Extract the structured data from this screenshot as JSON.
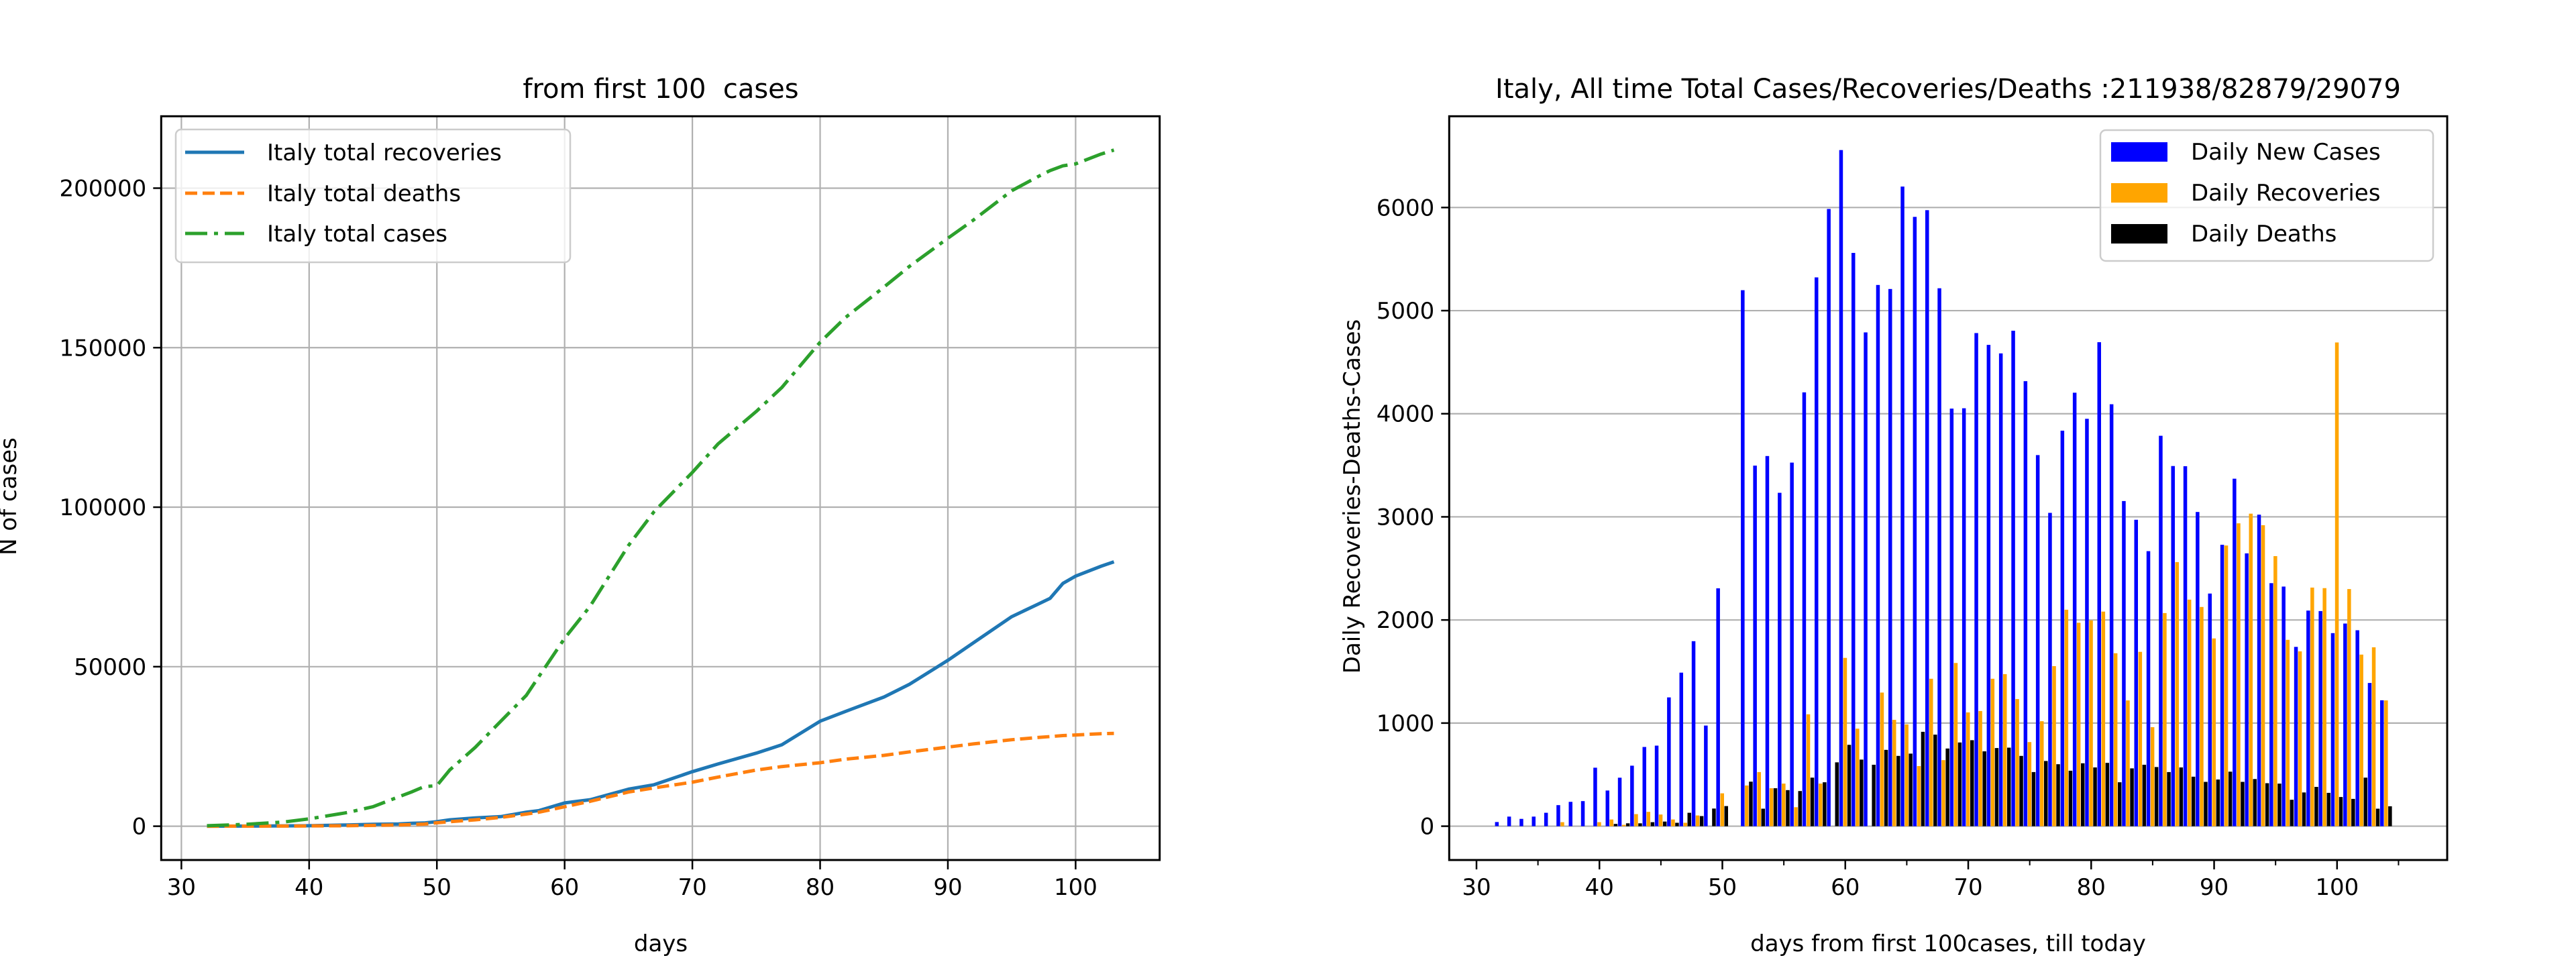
{
  "chart_data": [
    {
      "type": "line",
      "title": "from first 100  cases",
      "xlabel": "days",
      "ylabel": "N of cases",
      "xlim": [
        28.42,
        106.58
      ],
      "ylim": [
        -10597,
        222535
      ],
      "xticks": [
        30,
        40,
        50,
        60,
        70,
        80,
        90,
        100
      ],
      "yticks": [
        0,
        50000,
        100000,
        150000,
        200000
      ],
      "grid": "both",
      "legend_position": "upper-left",
      "x": [
        32,
        35,
        38,
        40,
        43,
        45,
        47,
        48,
        49,
        50,
        51,
        53,
        55,
        57,
        58,
        60,
        62,
        65,
        67,
        70,
        72,
        75,
        77,
        80,
        82,
        85,
        87,
        90,
        92,
        95,
        97,
        98,
        99,
        100,
        102,
        103
      ],
      "series": [
        {
          "name": "Italy total recoveries",
          "color": "#1f77b4",
          "style": "solid",
          "values": [
            0,
            50,
            100,
            150,
            400,
            600,
            700,
            900,
            1000,
            1400,
            2000,
            2600,
            3000,
            4400,
            4900,
            7300,
            8300,
            11600,
            13000,
            17100,
            19500,
            22900,
            25500,
            32900,
            36000,
            40500,
            44500,
            52000,
            57500,
            65700,
            69500,
            71400,
            76100,
            78400,
            81500,
            82879
          ]
        },
        {
          "name": "Italy total deaths",
          "color": "#ff7f0e",
          "style": "dashed",
          "values": [
            0,
            20,
            40,
            80,
            150,
            250,
            400,
            500,
            650,
            1070,
            1400,
            2000,
            2750,
            3800,
            4400,
            6100,
            7800,
            10700,
            12000,
            13800,
            15400,
            17600,
            18700,
            19900,
            21000,
            22200,
            23300,
            24800,
            25800,
            27100,
            27800,
            28100,
            28400,
            28600,
            29000,
            29079
          ]
        },
        {
          "name": "Italy total cases",
          "color": "#2ca02c",
          "style": "dashdot",
          "values": [
            150,
            600,
            1300,
            2300,
            4300,
            6100,
            9200,
            10700,
            12400,
            12700,
            17600,
            24700,
            32900,
            41000,
            47000,
            58900,
            69000,
            88000,
            98600,
            110900,
            119800,
            130000,
            137500,
            151700,
            159500,
            169000,
            175500,
            184300,
            190000,
            199200,
            203500,
            205500,
            207000,
            207600,
            210700,
            211938
          ]
        }
      ]
    },
    {
      "type": "bar",
      "title": "Italy, All time Total Cases/Recoveries/Deaths :211938/82879/29079",
      "xlabel": "days from first 100cases, till today",
      "ylabel": "Daily Recoveries-Deaths-Cases",
      "xlim": [
        27.78,
        108.96
      ],
      "ylim": [
        -328,
        6885
      ],
      "xticks": [
        30,
        40,
        50,
        60,
        70,
        80,
        90,
        100
      ],
      "xticks_minor": [
        35,
        45,
        55,
        65,
        75,
        85,
        95,
        105
      ],
      "yticks": [
        0,
        1000,
        2000,
        3000,
        4000,
        5000,
        6000
      ],
      "grid": "y",
      "legend_position": "upper-right",
      "x": [
        32,
        33,
        34,
        35,
        36,
        37,
        38,
        39,
        40,
        41,
        42,
        43,
        44,
        45,
        46,
        47,
        48,
        49,
        50,
        52,
        53,
        54,
        55,
        56,
        57,
        58,
        59,
        60,
        61,
        62,
        63,
        64,
        65,
        66,
        67,
        68,
        69,
        70,
        71,
        72,
        73,
        74,
        75,
        76,
        77,
        78,
        79,
        80,
        81,
        82,
        83,
        84,
        85,
        86,
        87,
        88,
        89,
        90,
        91,
        92,
        93,
        94,
        95,
        96,
        97,
        98,
        99,
        100,
        101,
        102,
        103,
        104
      ],
      "series": [
        {
          "name": "Daily New Cases",
          "color": "#0000ff",
          "values": [
            40,
            93,
            71,
            93,
            130,
            204,
            236,
            243,
            567,
            346,
            470,
            587,
            768,
            781,
            1249,
            1489,
            1794,
            976,
            2307,
            5198,
            3497,
            3590,
            3233,
            3526,
            4207,
            5322,
            5986,
            6557,
            5560,
            4789,
            5249,
            5210,
            6203,
            5909,
            5974,
            5217,
            4050,
            4053,
            4782,
            4668,
            4585,
            4805,
            4316,
            3599,
            3039,
            3836,
            4204,
            3951,
            4694,
            4092,
            3153,
            2972,
            2667,
            3786,
            3493,
            3491,
            3047,
            2256,
            2729,
            3370,
            2646,
            3021,
            2357,
            2324,
            1739,
            2091,
            2086,
            1872,
            1965,
            1900,
            1389,
            1221
          ]
        },
        {
          "name": "Daily Recoveries",
          "color": "#ffa500",
          "values": [
            0,
            0,
            0,
            0,
            0,
            39,
            0,
            0,
            39,
            65,
            13,
            117,
            139,
            113,
            65,
            33,
            104,
            0,
            319,
            395,
            525,
            368,
            413,
            184,
            1085,
            413,
            0,
            1632,
            946,
            0,
            1296,
            1031,
            987,
            583,
            1430,
            641,
            1583,
            1103,
            1117,
            1430,
            1475,
            1233,
            816,
            1018,
            1552,
            2099,
            1973,
            1996,
            2081,
            1677,
            1220,
            1691,
            960,
            2067,
            2561,
            2197,
            2126,
            1821,
            2722,
            2937,
            3031,
            2919,
            2619,
            1807,
            1695,
            2314,
            2309,
            4691,
            2300,
            1664,
            1735,
            1220
          ]
        },
        {
          "name": "Daily Deaths",
          "color": "#000000",
          "values": [
            0,
            0,
            0,
            0,
            0,
            0,
            0,
            0,
            0,
            22,
            28,
            28,
            39,
            45,
            33,
            130,
            98,
            171,
            195,
            432,
            170,
            368,
            350,
            341,
            471,
            426,
            619,
            789,
            646,
            596,
            740,
            682,
            704,
            915,
            888,
            753,
            812,
            834,
            726,
            758,
            762,
            682,
            525,
            632,
            601,
            538,
            610,
            570,
            614,
            426,
            561,
            596,
            574,
            525,
            570,
            480,
            430,
            453,
            529,
            430,
            457,
            417,
            413,
            256,
            327,
            381,
            323,
            283,
            265,
            471,
            170,
            193
          ]
        }
      ]
    }
  ]
}
